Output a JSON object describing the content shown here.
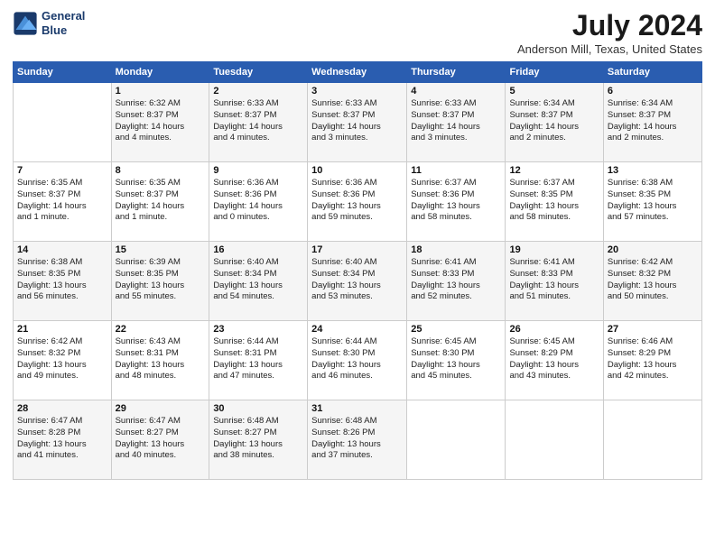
{
  "header": {
    "logo_line1": "General",
    "logo_line2": "Blue",
    "main_title": "July 2024",
    "subtitle": "Anderson Mill, Texas, United States"
  },
  "days_of_week": [
    "Sunday",
    "Monday",
    "Tuesday",
    "Wednesday",
    "Thursday",
    "Friday",
    "Saturday"
  ],
  "weeks": [
    [
      {
        "num": "",
        "info": ""
      },
      {
        "num": "1",
        "info": "Sunrise: 6:32 AM\nSunset: 8:37 PM\nDaylight: 14 hours\nand 4 minutes."
      },
      {
        "num": "2",
        "info": "Sunrise: 6:33 AM\nSunset: 8:37 PM\nDaylight: 14 hours\nand 4 minutes."
      },
      {
        "num": "3",
        "info": "Sunrise: 6:33 AM\nSunset: 8:37 PM\nDaylight: 14 hours\nand 3 minutes."
      },
      {
        "num": "4",
        "info": "Sunrise: 6:33 AM\nSunset: 8:37 PM\nDaylight: 14 hours\nand 3 minutes."
      },
      {
        "num": "5",
        "info": "Sunrise: 6:34 AM\nSunset: 8:37 PM\nDaylight: 14 hours\nand 2 minutes."
      },
      {
        "num": "6",
        "info": "Sunrise: 6:34 AM\nSunset: 8:37 PM\nDaylight: 14 hours\nand 2 minutes."
      }
    ],
    [
      {
        "num": "7",
        "info": "Sunrise: 6:35 AM\nSunset: 8:37 PM\nDaylight: 14 hours\nand 1 minute."
      },
      {
        "num": "8",
        "info": "Sunrise: 6:35 AM\nSunset: 8:37 PM\nDaylight: 14 hours\nand 1 minute."
      },
      {
        "num": "9",
        "info": "Sunrise: 6:36 AM\nSunset: 8:36 PM\nDaylight: 14 hours\nand 0 minutes."
      },
      {
        "num": "10",
        "info": "Sunrise: 6:36 AM\nSunset: 8:36 PM\nDaylight: 13 hours\nand 59 minutes."
      },
      {
        "num": "11",
        "info": "Sunrise: 6:37 AM\nSunset: 8:36 PM\nDaylight: 13 hours\nand 58 minutes."
      },
      {
        "num": "12",
        "info": "Sunrise: 6:37 AM\nSunset: 8:35 PM\nDaylight: 13 hours\nand 58 minutes."
      },
      {
        "num": "13",
        "info": "Sunrise: 6:38 AM\nSunset: 8:35 PM\nDaylight: 13 hours\nand 57 minutes."
      }
    ],
    [
      {
        "num": "14",
        "info": "Sunrise: 6:38 AM\nSunset: 8:35 PM\nDaylight: 13 hours\nand 56 minutes."
      },
      {
        "num": "15",
        "info": "Sunrise: 6:39 AM\nSunset: 8:35 PM\nDaylight: 13 hours\nand 55 minutes."
      },
      {
        "num": "16",
        "info": "Sunrise: 6:40 AM\nSunset: 8:34 PM\nDaylight: 13 hours\nand 54 minutes."
      },
      {
        "num": "17",
        "info": "Sunrise: 6:40 AM\nSunset: 8:34 PM\nDaylight: 13 hours\nand 53 minutes."
      },
      {
        "num": "18",
        "info": "Sunrise: 6:41 AM\nSunset: 8:33 PM\nDaylight: 13 hours\nand 52 minutes."
      },
      {
        "num": "19",
        "info": "Sunrise: 6:41 AM\nSunset: 8:33 PM\nDaylight: 13 hours\nand 51 minutes."
      },
      {
        "num": "20",
        "info": "Sunrise: 6:42 AM\nSunset: 8:32 PM\nDaylight: 13 hours\nand 50 minutes."
      }
    ],
    [
      {
        "num": "21",
        "info": "Sunrise: 6:42 AM\nSunset: 8:32 PM\nDaylight: 13 hours\nand 49 minutes."
      },
      {
        "num": "22",
        "info": "Sunrise: 6:43 AM\nSunset: 8:31 PM\nDaylight: 13 hours\nand 48 minutes."
      },
      {
        "num": "23",
        "info": "Sunrise: 6:44 AM\nSunset: 8:31 PM\nDaylight: 13 hours\nand 47 minutes."
      },
      {
        "num": "24",
        "info": "Sunrise: 6:44 AM\nSunset: 8:30 PM\nDaylight: 13 hours\nand 46 minutes."
      },
      {
        "num": "25",
        "info": "Sunrise: 6:45 AM\nSunset: 8:30 PM\nDaylight: 13 hours\nand 45 minutes."
      },
      {
        "num": "26",
        "info": "Sunrise: 6:45 AM\nSunset: 8:29 PM\nDaylight: 13 hours\nand 43 minutes."
      },
      {
        "num": "27",
        "info": "Sunrise: 6:46 AM\nSunset: 8:29 PM\nDaylight: 13 hours\nand 42 minutes."
      }
    ],
    [
      {
        "num": "28",
        "info": "Sunrise: 6:47 AM\nSunset: 8:28 PM\nDaylight: 13 hours\nand 41 minutes."
      },
      {
        "num": "29",
        "info": "Sunrise: 6:47 AM\nSunset: 8:27 PM\nDaylight: 13 hours\nand 40 minutes."
      },
      {
        "num": "30",
        "info": "Sunrise: 6:48 AM\nSunset: 8:27 PM\nDaylight: 13 hours\nand 38 minutes."
      },
      {
        "num": "31",
        "info": "Sunrise: 6:48 AM\nSunset: 8:26 PM\nDaylight: 13 hours\nand 37 minutes."
      },
      {
        "num": "",
        "info": ""
      },
      {
        "num": "",
        "info": ""
      },
      {
        "num": "",
        "info": ""
      }
    ]
  ]
}
